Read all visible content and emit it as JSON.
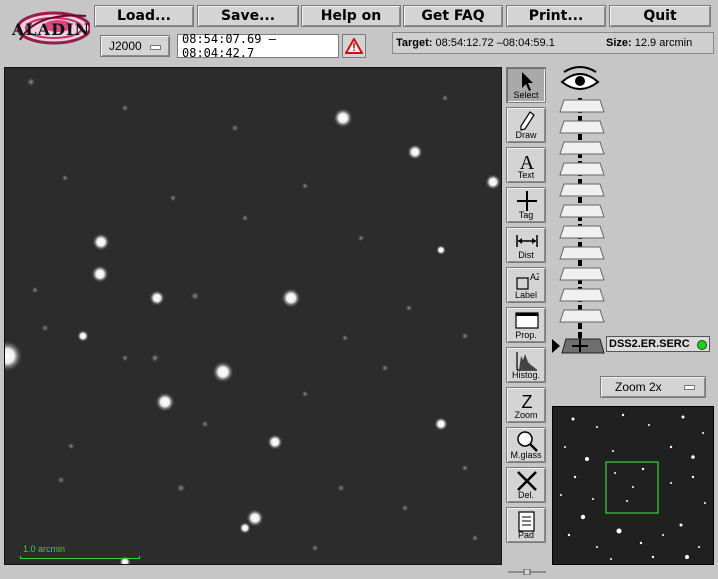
{
  "app": {
    "logo_text": "ALADIN"
  },
  "menu": {
    "load": "Load...",
    "save": "Save...",
    "help": "Help on",
    "faq": "Get FAQ",
    "print": "Print...",
    "quit": "Quit"
  },
  "frame_select": {
    "value": "J2000"
  },
  "coord_field": {
    "value": "08:54:07.69 –08:04:42.7"
  },
  "target": {
    "label": "Target:",
    "value": "08:54:12.72 –08:04:59.1"
  },
  "size": {
    "label": "Size:",
    "value": "12.9 arcmin"
  },
  "tools": [
    {
      "label": "Select",
      "icon": "arrow-cursor-icon",
      "active": true
    },
    {
      "label": "Draw",
      "icon": "pencil-icon"
    },
    {
      "label": "Text",
      "icon": "text-a-icon"
    },
    {
      "label": "Tag",
      "icon": "crosshair-icon"
    },
    {
      "label": "Dist",
      "icon": "distance-icon"
    },
    {
      "label": "Label",
      "icon": "label-icon"
    },
    {
      "label": "Prop.",
      "icon": "properties-icon"
    },
    {
      "label": "Histog.",
      "icon": "histogram-icon"
    },
    {
      "label": "Zoom",
      "icon": "zoom-z-icon"
    },
    {
      "label": "M.glass",
      "icon": "magnifier-icon"
    },
    {
      "label": "Del.",
      "icon": "delete-x-icon"
    },
    {
      "label": "Pad",
      "icon": "notepad-icon"
    }
  ],
  "stack": {
    "plane_name": "DSS2.ER.SERC",
    "status_color": "#22cc22"
  },
  "zoom": {
    "value": "Zoom 2x"
  },
  "scale": {
    "label": "1.0 arcmin"
  },
  "colors": {
    "panel": "#c6c6c6",
    "sky": "#2b2b2b",
    "overlay_green": "#3bd13b"
  }
}
